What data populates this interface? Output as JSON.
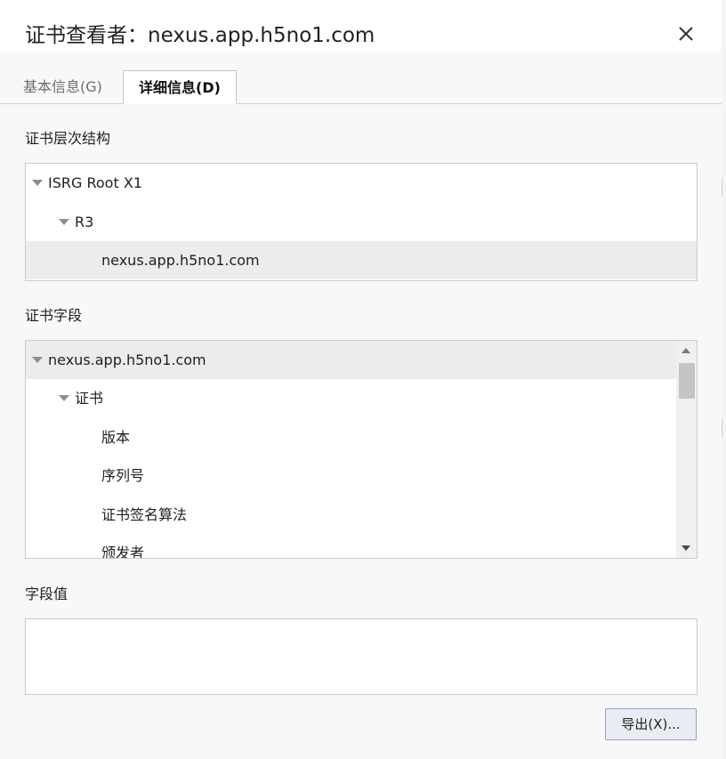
{
  "dialog": {
    "title": "证书查看者：nexus.app.h5no1.com",
    "close_icon": "close-icon"
  },
  "tabs": [
    {
      "label": "基本信息(G)",
      "active": false
    },
    {
      "label": "详细信息(D)",
      "active": true
    }
  ],
  "hierarchy": {
    "label": "证书层次结构",
    "items": [
      {
        "text": "ISRG Root X1",
        "expanded": true,
        "selected": false
      },
      {
        "text": "R3",
        "expanded": true,
        "selected": false
      },
      {
        "text": "nexus.app.h5no1.com",
        "expanded": false,
        "selected": true
      }
    ]
  },
  "fields": {
    "label": "证书字段",
    "items": [
      {
        "text": "nexus.app.h5no1.com",
        "expanded": true,
        "selected": true
      },
      {
        "text": "证书",
        "expanded": true,
        "selected": false
      },
      {
        "text": "版本",
        "selected": false
      },
      {
        "text": "序列号",
        "selected": false
      },
      {
        "text": "证书签名算法",
        "selected": false
      },
      {
        "text": "颁发者",
        "selected": false
      }
    ]
  },
  "field_value": {
    "label": "字段值",
    "value": ""
  },
  "export_button": {
    "label": "导出(X)..."
  },
  "colors": {
    "dialog_bg": "#f8f8f8",
    "selected_row": "#ececec",
    "button_border": "#8fa1c9"
  }
}
